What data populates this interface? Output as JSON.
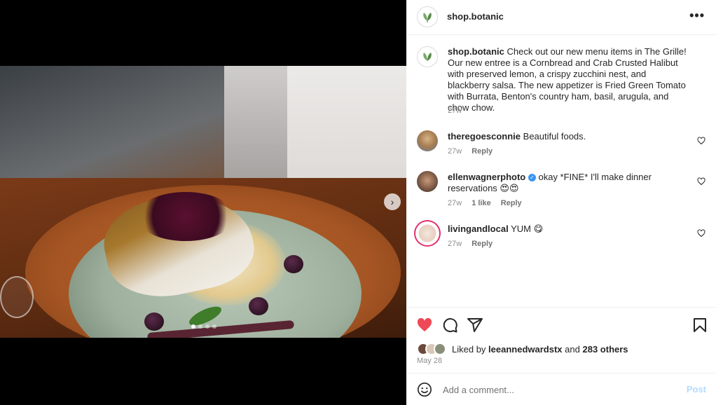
{
  "post": {
    "username": "shop.botanic",
    "more_icon": "more-horizontal-icon",
    "carousel": {
      "total_slides": 4,
      "active_slide": 1
    }
  },
  "caption": {
    "username": "shop.botanic",
    "text": "Check out our new menu items in The Grille! Our new entree is a Cornbread and Crab Crusted Halibut with preserved lemon, a crispy zucchini nest, and blackberry salsa. The new appetizer is Fried Green Tomato with Burrata, Benton's country ham, basil, arugula, and chow chow.",
    "age": "27w"
  },
  "comments": [
    {
      "username": "theregoesconnie",
      "text": "Beautiful foods.",
      "age": "27w",
      "likes": "",
      "reply": "Reply",
      "verified": false
    },
    {
      "username": "ellenwagnerphoto",
      "text": "okay *FINE* I'll make dinner reservations 😍😍",
      "age": "27w",
      "likes": "1 like",
      "reply": "Reply",
      "verified": true
    },
    {
      "username": "livingandlocal",
      "text": "YUM 😋",
      "age": "27w",
      "likes": "",
      "reply": "Reply",
      "verified": false
    }
  ],
  "actions": {
    "liked": true,
    "like_color": "#ed4956",
    "liked_by_prefix": "Liked by",
    "liked_by_user": "leeannedwardstx",
    "liked_by_and": "and",
    "liked_by_others": "283 others",
    "date": "May 28"
  },
  "composer": {
    "placeholder": "Add a comment...",
    "post_label": "Post"
  }
}
